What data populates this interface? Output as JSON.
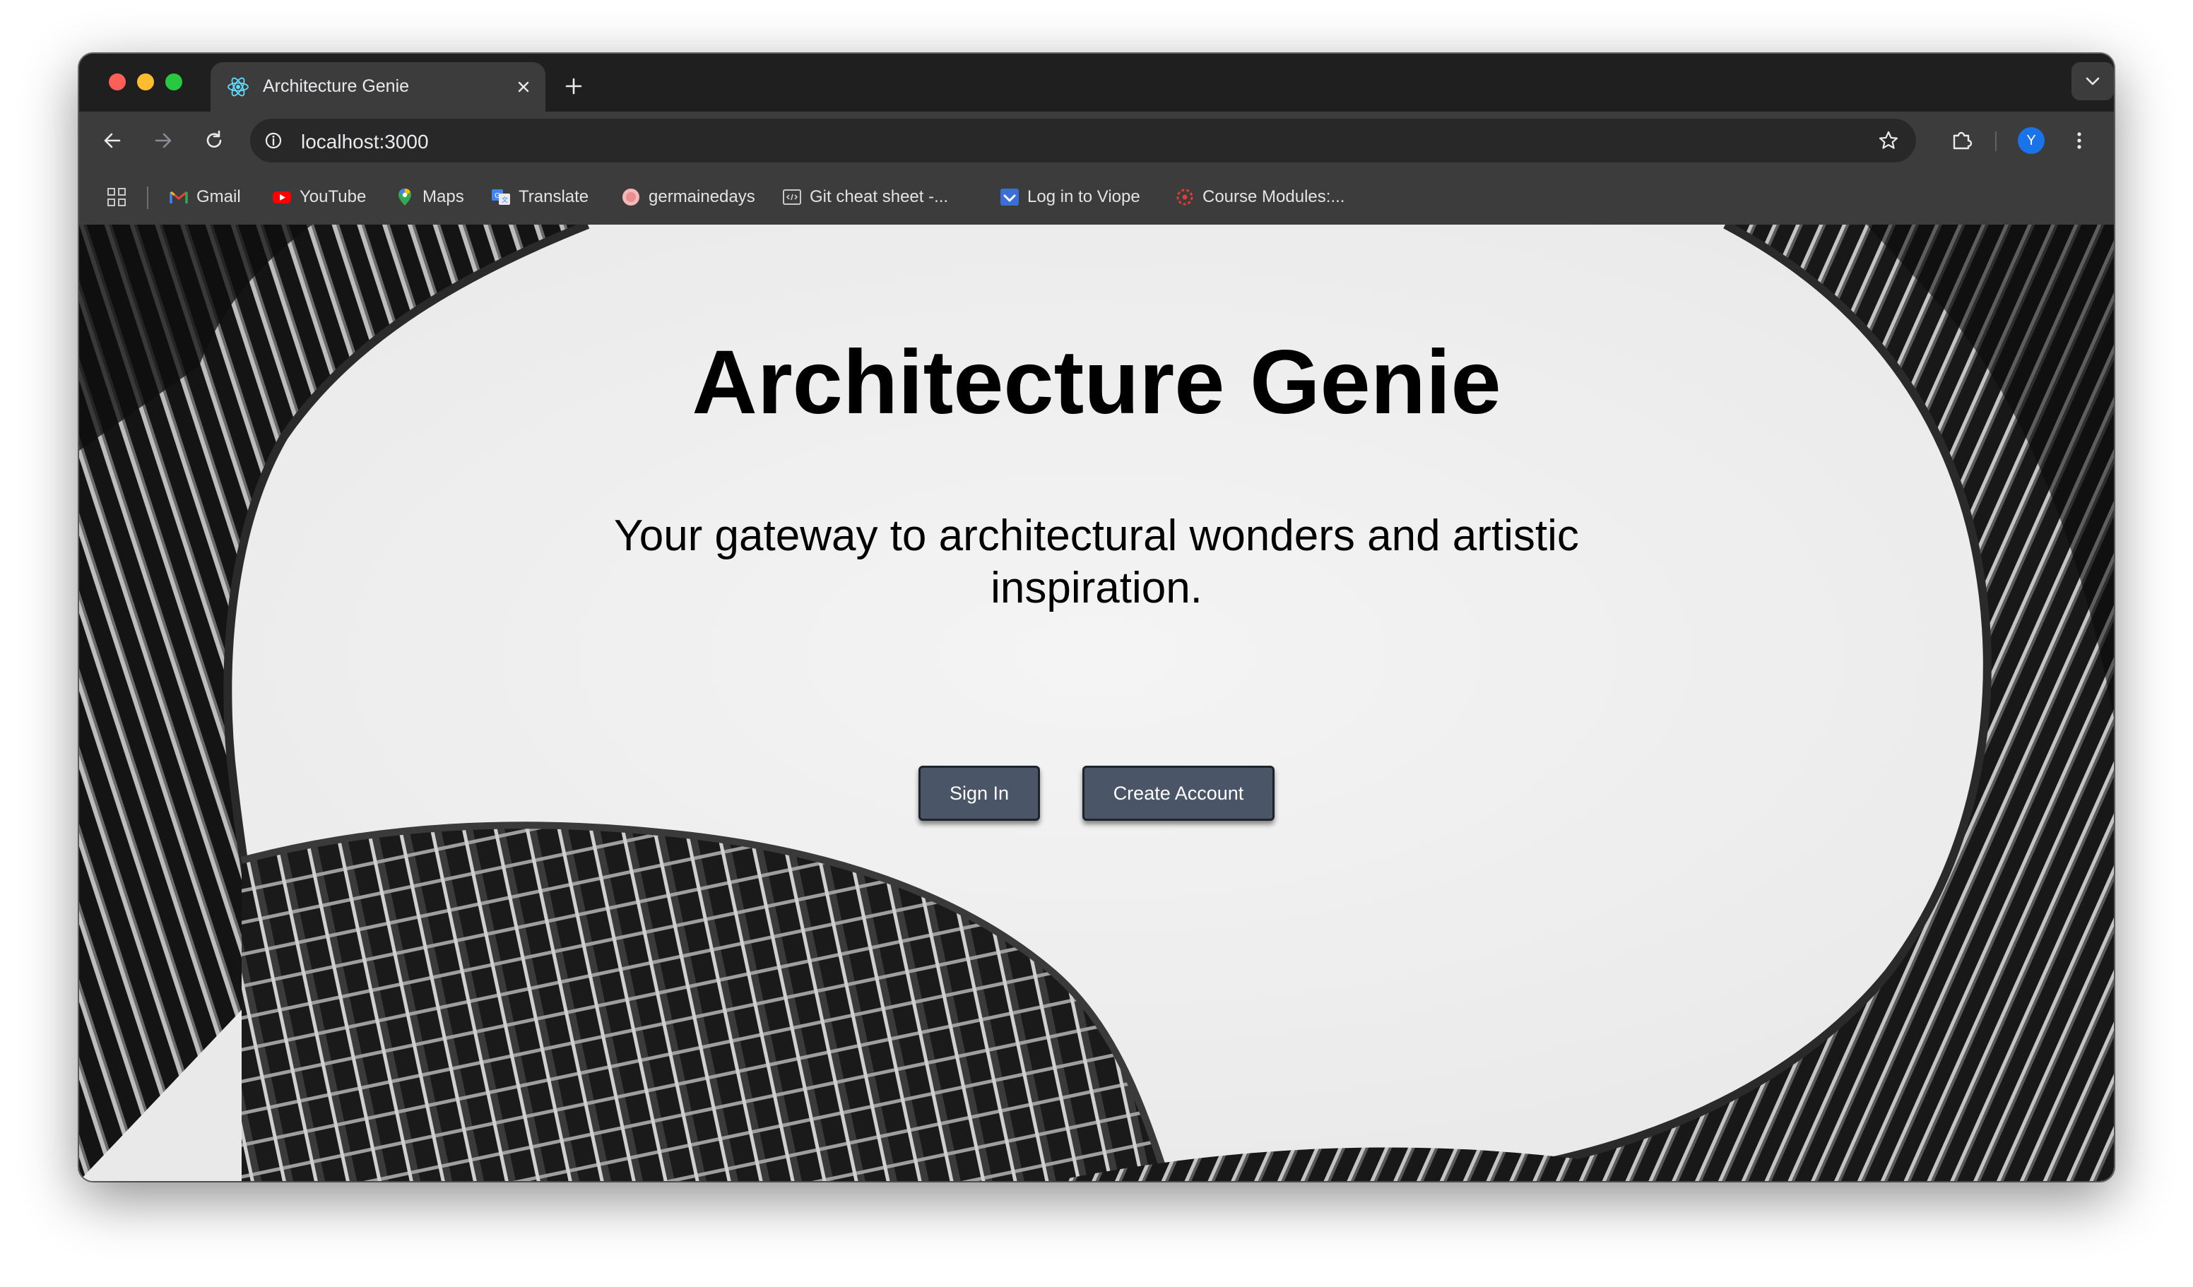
{
  "browser": {
    "tab": {
      "title": "Architecture Genie",
      "favicon": "react-icon"
    },
    "address_bar": {
      "url": "localhost:3000"
    },
    "profile_initial": "Y",
    "bookmarks": [
      {
        "label": "Gmail",
        "icon": "gmail-icon"
      },
      {
        "label": "YouTube",
        "icon": "youtube-icon"
      },
      {
        "label": "Maps",
        "icon": "maps-icon"
      },
      {
        "label": "Translate",
        "icon": "translate-icon"
      },
      {
        "label": "germainedays",
        "icon": "germainedays-icon"
      },
      {
        "label": "Git cheat sheet -...",
        "icon": "code-icon"
      },
      {
        "label": "Log in to Viope",
        "icon": "viope-icon"
      },
      {
        "label": "Course Modules:...",
        "icon": "course-icon"
      }
    ]
  },
  "page": {
    "title": "Architecture Genie",
    "subtitle": "Your gateway to architectural wonders and artistic inspiration.",
    "buttons": {
      "sign_in": "Sign In",
      "create_account": "Create Account"
    }
  },
  "colors": {
    "button_bg": "#4a5568",
    "page_bg": "#efefef",
    "browser_chrome": "#3c3c3c"
  }
}
